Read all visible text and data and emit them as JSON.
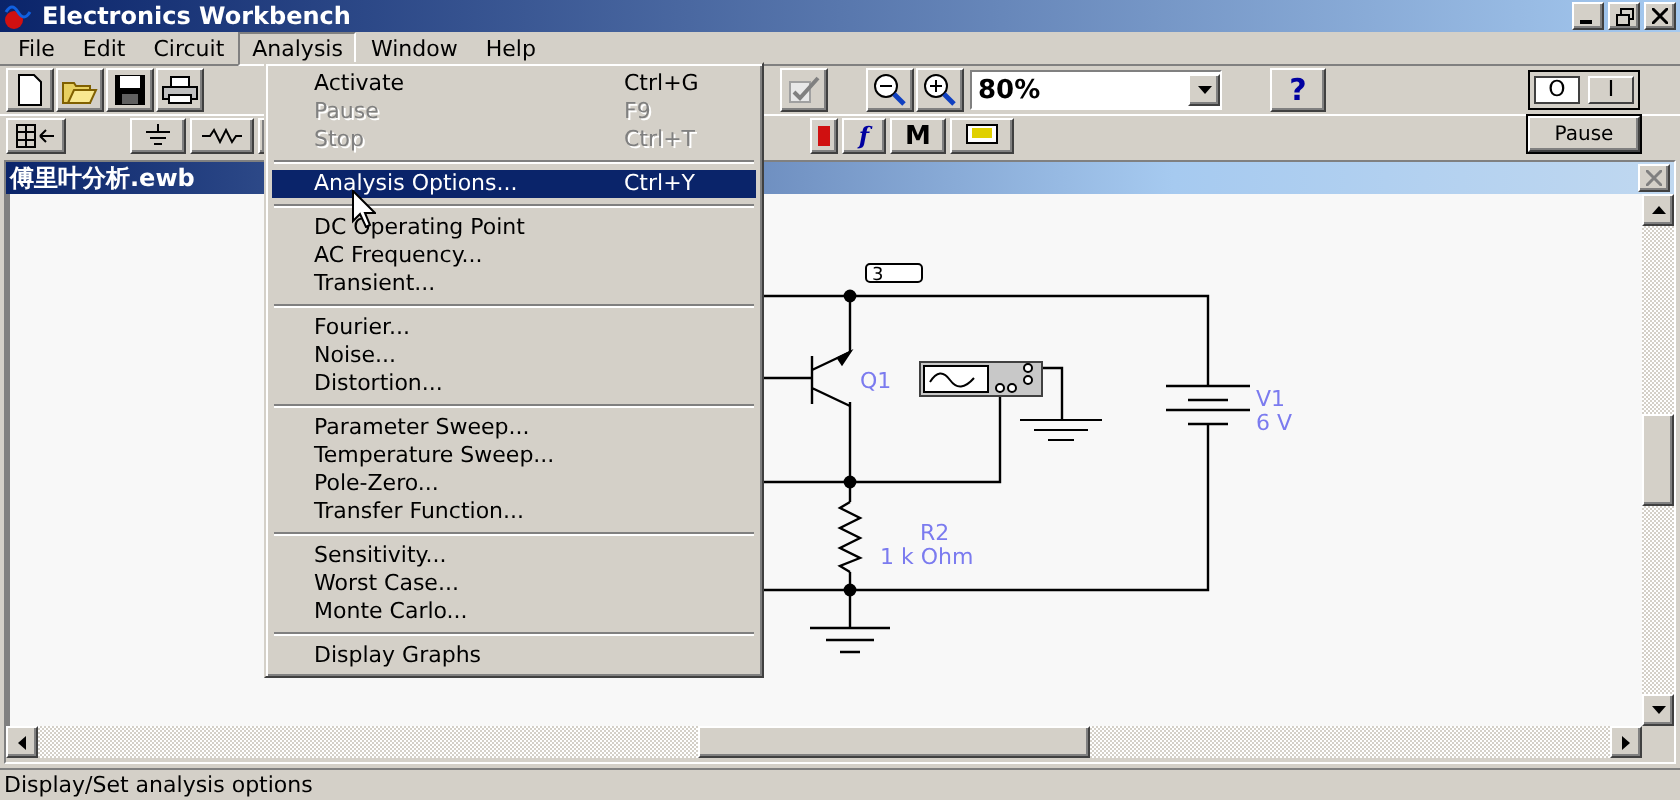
{
  "window": {
    "title": "Electronics Workbench"
  },
  "menubar": [
    {
      "label": "File",
      "selected": false
    },
    {
      "label": "Edit",
      "selected": false
    },
    {
      "label": "Circuit",
      "selected": false
    },
    {
      "label": "Analysis",
      "selected": true
    },
    {
      "label": "Window",
      "selected": false
    },
    {
      "label": "Help",
      "selected": false
    }
  ],
  "analysis_menu": [
    {
      "kind": "item",
      "label": "Activate",
      "shortcut": "Ctrl+G",
      "disabled": false,
      "selected": false
    },
    {
      "kind": "item",
      "label": "Pause",
      "shortcut": "F9",
      "disabled": true,
      "selected": false
    },
    {
      "kind": "item",
      "label": "Stop",
      "shortcut": "Ctrl+T",
      "disabled": true,
      "selected": false
    },
    {
      "kind": "separator"
    },
    {
      "kind": "item",
      "label": "Analysis Options...",
      "shortcut": "Ctrl+Y",
      "disabled": false,
      "selected": true
    },
    {
      "kind": "separator"
    },
    {
      "kind": "item",
      "label": "DC Operating Point",
      "disabled": false,
      "selected": false
    },
    {
      "kind": "item",
      "label": "AC Frequency...",
      "disabled": false,
      "selected": false
    },
    {
      "kind": "item",
      "label": "Transient...",
      "disabled": false,
      "selected": false
    },
    {
      "kind": "separator"
    },
    {
      "kind": "item",
      "label": "Fourier...",
      "disabled": false,
      "selected": false
    },
    {
      "kind": "item",
      "label": "Noise...",
      "disabled": false,
      "selected": false
    },
    {
      "kind": "item",
      "label": "Distortion...",
      "disabled": false,
      "selected": false
    },
    {
      "kind": "separator"
    },
    {
      "kind": "item",
      "label": "Parameter Sweep...",
      "disabled": false,
      "selected": false
    },
    {
      "kind": "item",
      "label": "Temperature Sweep...",
      "disabled": false,
      "selected": false
    },
    {
      "kind": "item",
      "label": "Pole-Zero...",
      "disabled": false,
      "selected": false
    },
    {
      "kind": "item",
      "label": "Transfer Function...",
      "disabled": false,
      "selected": false
    },
    {
      "kind": "separator"
    },
    {
      "kind": "item",
      "label": "Sensitivity...",
      "disabled": false,
      "selected": false
    },
    {
      "kind": "item",
      "label": "Worst Case...",
      "disabled": false,
      "selected": false
    },
    {
      "kind": "item",
      "label": "Monte Carlo...",
      "disabled": false,
      "selected": false
    },
    {
      "kind": "separator"
    },
    {
      "kind": "item",
      "label": "Display Graphs",
      "disabled": false,
      "selected": false
    }
  ],
  "toolbar": {
    "zoom": {
      "value": "80%"
    },
    "help_label": "?"
  },
  "power_switch": {
    "off_label": "O",
    "on_label": "I",
    "on": false
  },
  "pause_button": {
    "label": "Pause"
  },
  "parts_bin": [
    {
      "label": "f"
    },
    {
      "label": "M"
    }
  ],
  "document": {
    "title": "傅里叶分析.ewb"
  },
  "circuit": {
    "node_label": "3",
    "transistor": "Q1",
    "battery": {
      "name": "V1",
      "value": "6 V"
    },
    "resistor": {
      "name": "R2",
      "value": "1 k Ohm"
    }
  },
  "status_bar": {
    "text": "Display/Set analysis options"
  }
}
